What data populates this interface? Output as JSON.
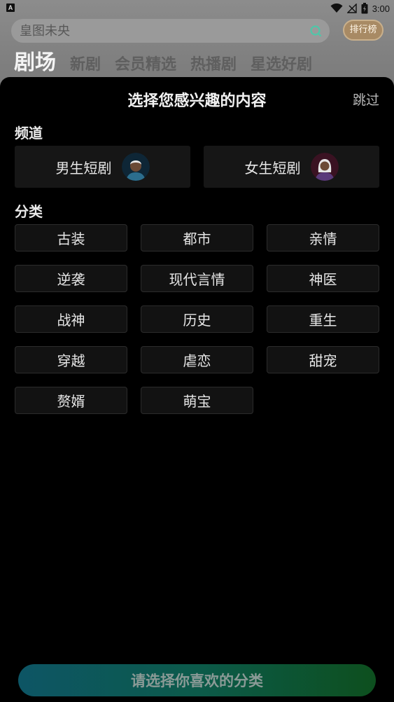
{
  "status_bar": {
    "app_icon_letter": "A",
    "time": "3:00",
    "icons": [
      "wifi-icon",
      "signal-icon",
      "battery-icon"
    ]
  },
  "search": {
    "placeholder": "皇图未央",
    "icon": "search-icon"
  },
  "rank_badge": {
    "label": "排行榜"
  },
  "top_tabs": [
    {
      "label": "剧场",
      "active": true
    },
    {
      "label": "新剧",
      "active": false
    },
    {
      "label": "会员精选",
      "active": false
    },
    {
      "label": "热播剧",
      "active": false
    },
    {
      "label": "星选好剧",
      "active": false
    }
  ],
  "sheet": {
    "title": "选择您感兴趣的内容",
    "skip_label": "跳过",
    "channel_section_label": "频道",
    "channels": [
      {
        "label": "男生短剧",
        "avatar": "male-avatar-icon"
      },
      {
        "label": "女生短剧",
        "avatar": "female-avatar-icon"
      }
    ],
    "category_section_label": "分类",
    "categories": [
      "古装",
      "都市",
      "亲情",
      "逆袭",
      "现代言情",
      "神医",
      "战神",
      "历史",
      "重生",
      "穿越",
      "虐恋",
      "甜宠",
      "赘婿",
      "萌宝"
    ],
    "cta_label": "请选择你喜欢的分类"
  },
  "colors": {
    "accent_teal": "#0d5565",
    "accent_green": "#0d4f1e",
    "background": "#000000",
    "card": "#161616"
  }
}
